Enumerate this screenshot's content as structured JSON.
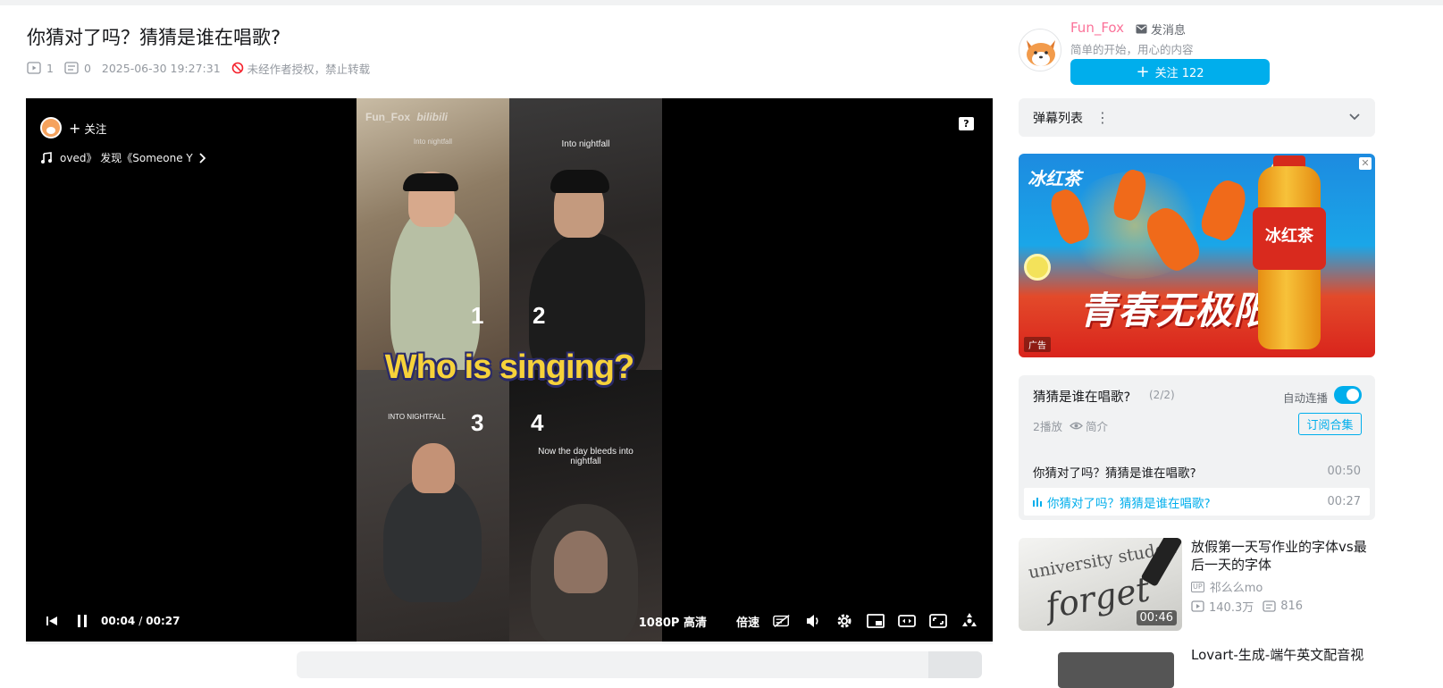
{
  "video": {
    "title": "你猜对了吗？猜猜是谁在唱歌?",
    "plays": "1",
    "danmaku_count": "0",
    "pubdate": "2025-06-30 19:27:31",
    "copyright_notice": "未经作者授权，禁止转载"
  },
  "player": {
    "follow_label": "关注",
    "music_text": "oved》 发现《Someone Y",
    "watermark": "Fun_Fox",
    "watermark_brand": "bilibili",
    "overlay_text": "Who is singing?",
    "q1_caption": "Into nightfall",
    "q2_caption": "Into nightfall",
    "q3_caption": "INTO NIGHTFALL",
    "q4_caption": "Now the day bleeds into nightfall",
    "q1_num": "1",
    "q2_num": "2",
    "q3_num": "3",
    "q4_num": "4",
    "current_time": "00:04",
    "time_sep": "/",
    "duration": "00:27",
    "quality": "1080P 高清",
    "speed": "倍速",
    "help_icon": "?"
  },
  "uploader": {
    "name": "Fun_Fox",
    "message_label": "发消息",
    "bio": "简单的开始，用心的内容",
    "follow_label": "关注 122"
  },
  "danmaku_panel": {
    "title": "弹幕列表",
    "more_icon": "⋮"
  },
  "ad": {
    "logo": "冰红茶",
    "slogan": "青春无极限",
    "bottle_label": "冰红茶",
    "tag": "广告",
    "close": "✕"
  },
  "collection": {
    "title": "猜猜是谁在唱歌?",
    "count": "(2/2)",
    "autoplay_label": "自动连播",
    "plays": "2播放",
    "intro_label": "简介",
    "subscribe_label": "订阅合集",
    "episodes": [
      {
        "title": "你猜对了吗？猜猜是谁在唱歌?",
        "duration": "00:50"
      },
      {
        "title": "你猜对了吗？猜猜是谁在唱歌?",
        "duration": "00:27"
      }
    ]
  },
  "recommendations": [
    {
      "title": "放假第一天写作业的字体vs最后一天的字体",
      "up": "祁么么mo",
      "views": "140.3万",
      "comments": "816",
      "duration": "00:46",
      "thumb_text_1": "university studen",
      "thumb_text_2": "forget"
    },
    {
      "title": "Lovart-生成-端午英文配音视"
    }
  ],
  "colors": {
    "accent": "#00aeec",
    "up_name": "#fb7299",
    "muted": "#9499a0"
  }
}
